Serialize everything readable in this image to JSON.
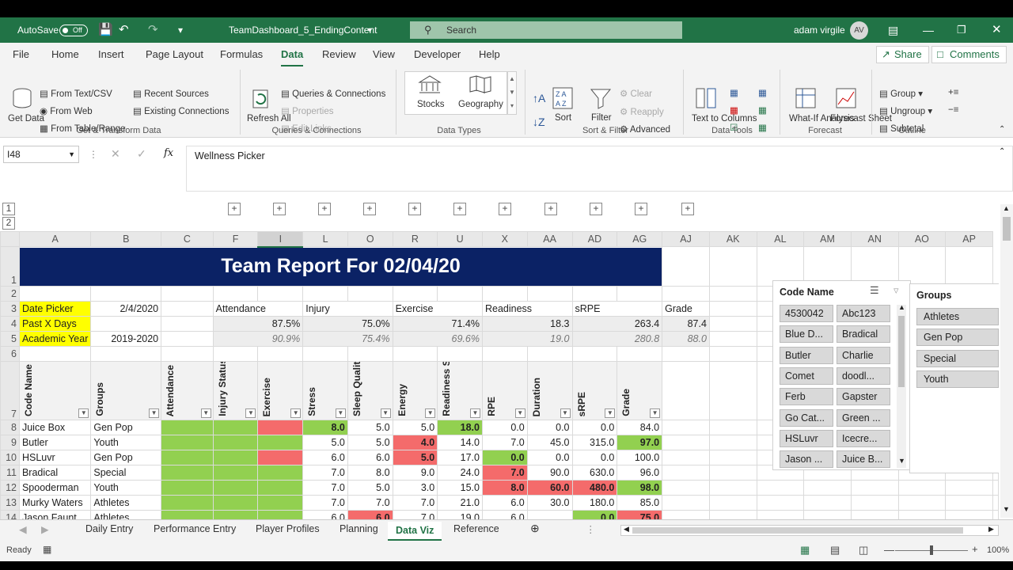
{
  "titlebar": {
    "autosave": "AutoSave",
    "toggle": "Off",
    "filename": "TeamDashboard_5_EndingContent",
    "search": "Search",
    "user": "adam virgile",
    "initials": "AV"
  },
  "menu": [
    "File",
    "Home",
    "Insert",
    "Page Layout",
    "Formulas",
    "Data",
    "Review",
    "View",
    "Developer",
    "Help"
  ],
  "share": "Share",
  "comments": "Comments",
  "ribbon": {
    "get_data": "Get Data",
    "from_text": "From Text/CSV",
    "from_web": "From Web",
    "from_table": "From Table/Range",
    "recent": "Recent Sources",
    "existing": "Existing Connections",
    "grp_get": "Get & Transform Data",
    "refresh": "Refresh All",
    "queries": "Queries & Connections",
    "properties": "Properties",
    "edit_links": "Edit Links",
    "grp_queries": "Queries & Connections",
    "stocks": "Stocks",
    "geography": "Geography",
    "grp_types": "Data Types",
    "sort": "Sort",
    "filter": "Filter",
    "clear": "Clear",
    "reapply": "Reapply",
    "advanced": "Advanced",
    "grp_sort": "Sort & Filter",
    "text_cols": "Text to Columns",
    "grp_tools": "Data Tools",
    "whatif": "What-If Analysis",
    "forecast_sheet": "Forecast Sheet",
    "grp_forecast": "Forecast",
    "group": "Group",
    "ungroup": "Ungroup",
    "subtotal": "Subtotal",
    "grp_outline": "Outline"
  },
  "formula": {
    "namebox": "I48",
    "content": "Wellness Picker"
  },
  "columns": [
    "A",
    "B",
    "C",
    "F",
    "I",
    "L",
    "O",
    "R",
    "U",
    "X",
    "AA",
    "AD",
    "AG",
    "AJ",
    "AK",
    "AL",
    "AM",
    "AN",
    "AO",
    "AP"
  ],
  "rows": [
    "1",
    "2",
    "3",
    "4",
    "5",
    "6",
    "7",
    "8",
    "9",
    "10",
    "11",
    "12",
    "13",
    "14"
  ],
  "sheet": {
    "title": "Team Report For 02/04/20",
    "date_picker": "Date Picker",
    "date_val": "2/4/2020",
    "past": "Past X Days",
    "academic": "Academic Year",
    "year_val": "2019-2020",
    "metrics": [
      "Attendance",
      "Injury",
      "Exercise",
      "Readiness",
      "sRPE",
      "Grade"
    ],
    "past_vals": [
      "87.5%",
      "75.0%",
      "71.4%",
      "18.3",
      "263.4",
      "87.4"
    ],
    "year_vals": [
      "90.9%",
      "75.4%",
      "69.6%",
      "19.0",
      "280.8",
      "88.0"
    ],
    "headers": [
      "Code Name",
      "Groups",
      "Attendance",
      "Injury Status",
      "Exercise",
      "Stress",
      "Sleep Quality",
      "Energy",
      "Readiness Score",
      "RPE",
      "Duration",
      "sRPE",
      "Grade"
    ],
    "data": [
      [
        "Juice Box",
        "Gen Pop",
        "8.0",
        "5.0",
        "5.0",
        "18.0",
        "0.0",
        "0.0",
        "0.0",
        "84.0"
      ],
      [
        "Butler",
        "Youth",
        "5.0",
        "5.0",
        "4.0",
        "14.0",
        "7.0",
        "45.0",
        "315.0",
        "97.0"
      ],
      [
        "HSLuvr",
        "Gen Pop",
        "6.0",
        "6.0",
        "5.0",
        "17.0",
        "0.0",
        "0.0",
        "0.0",
        "100.0"
      ],
      [
        "Bradical",
        "Special",
        "7.0",
        "8.0",
        "9.0",
        "24.0",
        "7.0",
        "90.0",
        "630.0",
        "96.0"
      ],
      [
        "Spooderman",
        "Youth",
        "7.0",
        "5.0",
        "3.0",
        "15.0",
        "8.0",
        "60.0",
        "480.0",
        "98.0"
      ],
      [
        "Murky Waters",
        "Athletes",
        "7.0",
        "7.0",
        "7.0",
        "21.0",
        "6.0",
        "30.0",
        "180.0",
        "85.0"
      ],
      [
        "Jason Faunt",
        "Athletes",
        "6.0",
        "6.0",
        "7.0",
        "19.0",
        "6.0",
        "",
        "0.0",
        "75.0"
      ]
    ]
  },
  "slicer_code": {
    "title": "Code Name",
    "items": [
      "4530042",
      "Abc123",
      "Blue D...",
      "Bradical",
      "Butler",
      "Charlie",
      "Comet",
      "doodl...",
      "Ferb",
      "Gapster",
      "Go Cat...",
      "Green ...",
      "HSLuvr",
      "Icecre...",
      "Jason ...",
      "Juice B..."
    ]
  },
  "slicer_groups": {
    "title": "Groups",
    "items": [
      "Athletes",
      "Gen Pop",
      "Special",
      "Youth"
    ]
  },
  "tabs": [
    "Daily Entry",
    "Performance Entry",
    "Player Profiles",
    "Planning",
    "Data Viz",
    "Reference"
  ],
  "status": {
    "ready": "Ready",
    "zoom": "100%"
  }
}
